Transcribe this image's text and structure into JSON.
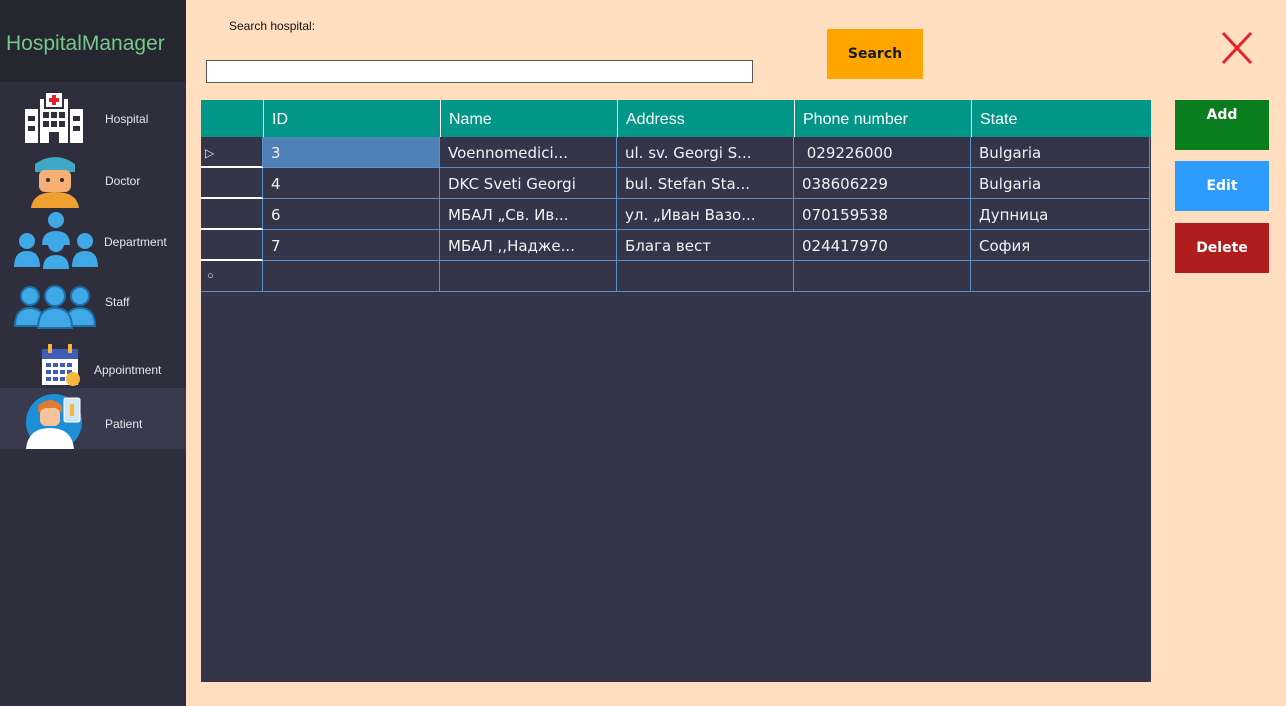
{
  "sidebar": {
    "title": "HospitalManager",
    "items": [
      {
        "label": "Hospital",
        "icon": "hospital-icon"
      },
      {
        "label": "Doctor",
        "icon": "doctor-icon"
      },
      {
        "label": "Department",
        "icon": "department-icon"
      },
      {
        "label": "Staff",
        "icon": "staff-icon"
      },
      {
        "label": "Appointment",
        "icon": "appointment-icon"
      },
      {
        "label": "Patient",
        "icon": "patient-icon",
        "active": true
      }
    ]
  },
  "search": {
    "label": "Search hospital:",
    "value": "",
    "button_label": "Search"
  },
  "close": {
    "label": "X",
    "color": "#e8202a"
  },
  "table": {
    "columns": [
      "ID",
      "Name",
      "Address",
      "Phone number",
      "State"
    ],
    "rows": [
      [
        "3",
        "Voennomedici...",
        "ul. sv. Georgi S...",
        " 029226000",
        "Bulgaria"
      ],
      [
        "4",
        "DKC Sveti Georgi",
        "bul. Stefan Sta...",
        "038606229",
        "Bulgaria"
      ],
      [
        "6",
        "МБАЛ „Св. Ив...",
        "ул. „Иван Вазо...",
        "070159538",
        "Дупница"
      ],
      [
        "7",
        "МБАЛ ,,Надже...",
        "Блага вест",
        "024417970",
        "София"
      ]
    ],
    "current_row_marker": "▷",
    "new_row_marker": "○"
  },
  "actions": {
    "add_label": "Add",
    "edit_label": "Edit",
    "delete_label": "Delete"
  },
  "colors": {
    "sidebar_bg": "#2e2e3d",
    "brand_text": "#74c98a",
    "page_bg": "#ffdfc0",
    "grid_header": "#009688",
    "grid_bg": "#35354a",
    "selected_cell": "#4f80b6",
    "search_button": "#ffa500",
    "add": "#0a7e1e",
    "edit": "#2e9bff",
    "delete": "#b01d1d"
  }
}
